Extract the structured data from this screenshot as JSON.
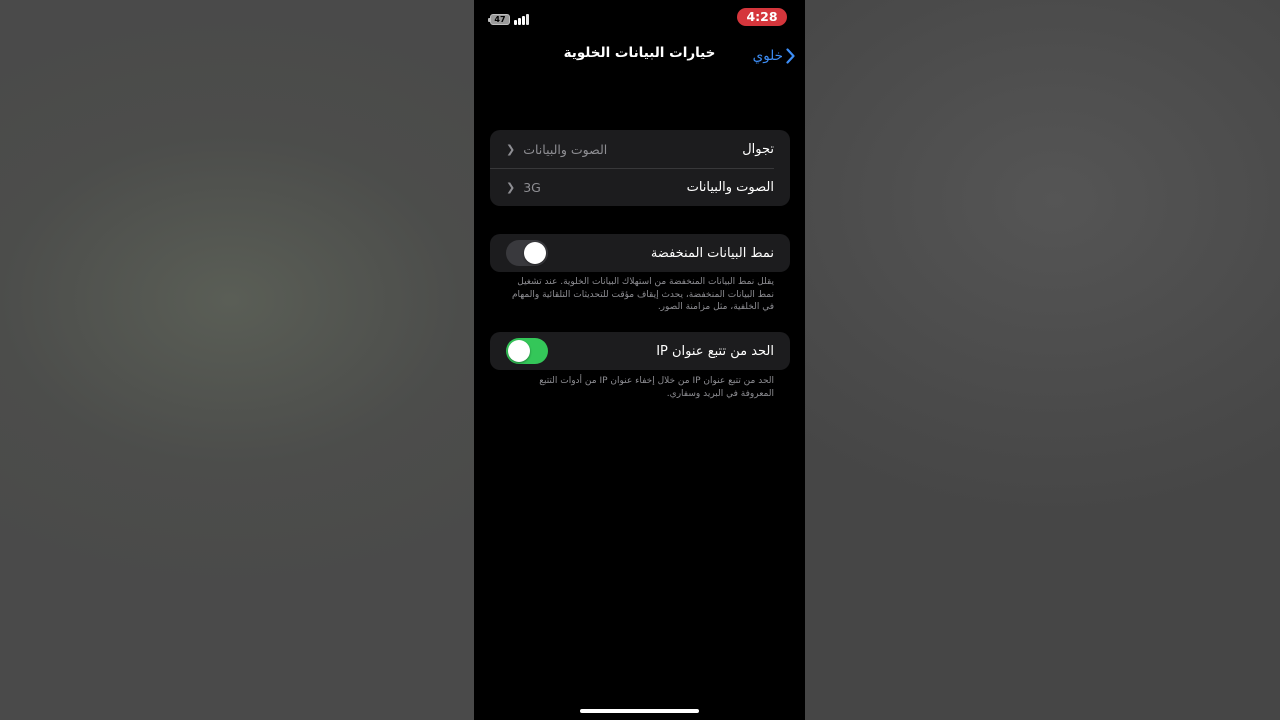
{
  "status": {
    "time": "4:28",
    "battery": "47"
  },
  "nav": {
    "title": "خيارات البيانات الخلوية",
    "back_label": "خلوي"
  },
  "group1": {
    "rows": [
      {
        "title": "تجوال",
        "value": "الصوت والبيانات"
      },
      {
        "title": "الصوت والبيانات",
        "value": "3G"
      }
    ]
  },
  "low_data": {
    "title": "نمط البيانات المنخفضة",
    "enabled": false,
    "footnote": "يقلل نمط البيانات المنخفضة من استهلاك البيانات الخلوية. عند تشغيل نمط البيانات المنخفضة، يحدث إيقاف مؤقت للتحديثات التلقائية والمهام في الخلفية، مثل مزامنة الصور."
  },
  "ip_tracking": {
    "title": "الحد من تتبع عنوان IP",
    "enabled": true,
    "footnote": "الحد من تتبع عنوان IP من خلال إخفاء عنوان IP من أدوات التتبع المعروفة في البريد وسفاري."
  },
  "colors": {
    "accent": "#3d8ef7",
    "toggle_on": "#34c759",
    "time_badge": "#d5363c"
  }
}
